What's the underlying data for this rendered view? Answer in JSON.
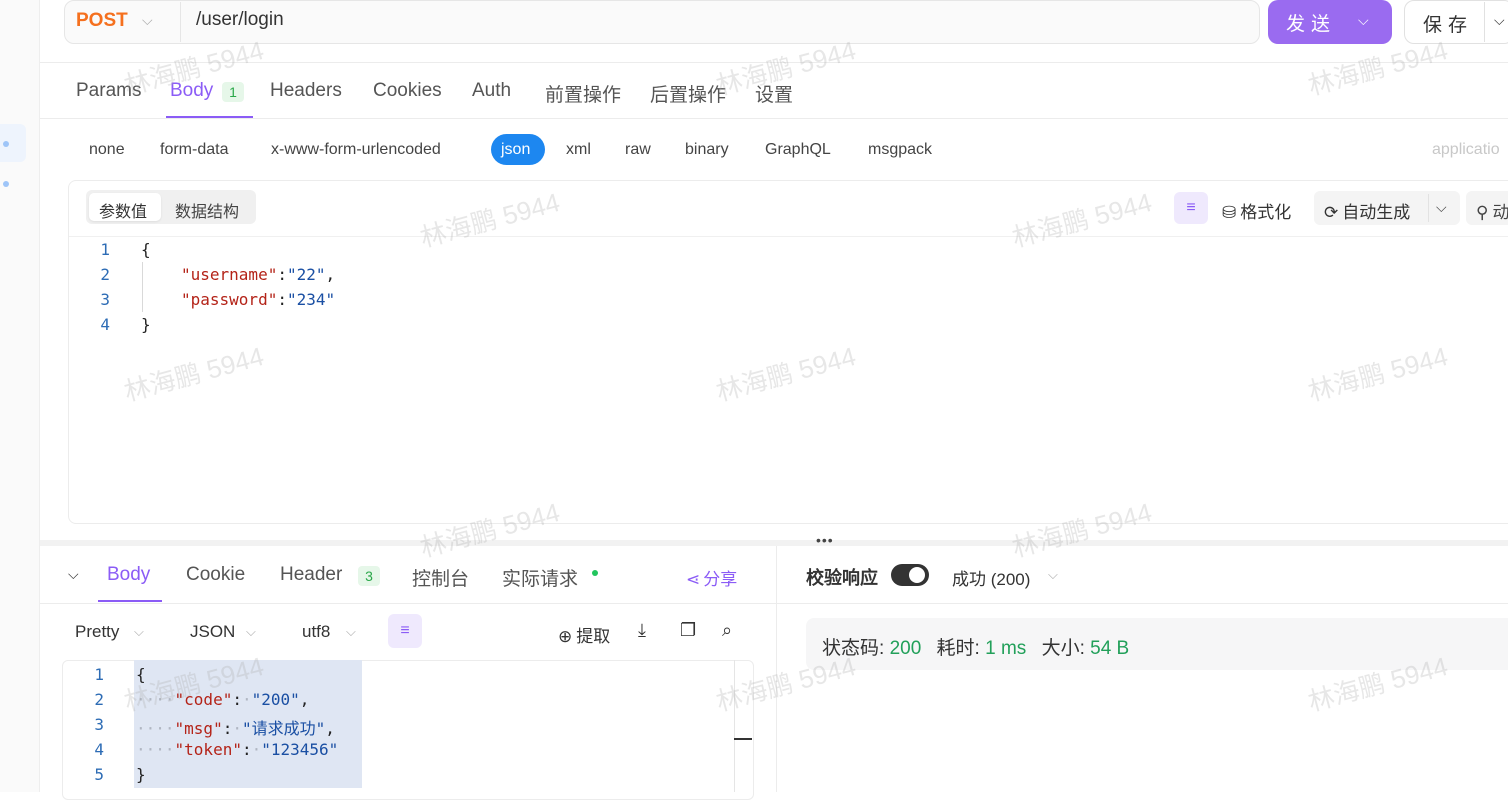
{
  "request": {
    "method": "POST",
    "url": "/user/login",
    "send_label": "发送",
    "save_label": "保存"
  },
  "request_tabs": [
    {
      "label": "Params"
    },
    {
      "label": "Body",
      "count": "1",
      "active": true
    },
    {
      "label": "Headers"
    },
    {
      "label": "Cookies"
    },
    {
      "label": "Auth"
    },
    {
      "label": "前置操作"
    },
    {
      "label": "后置操作"
    },
    {
      "label": "设置"
    }
  ],
  "body_types": [
    "none",
    "form-data",
    "x-www-form-urlencoded",
    "json",
    "xml",
    "raw",
    "binary",
    "GraphQL",
    "msgpack"
  ],
  "body_type_selected": "json",
  "content_type": "applicatio",
  "editor": {
    "segments": [
      "参数值",
      "数据结构"
    ],
    "format_label": "格式化",
    "autogen_label": "自动生成",
    "dynamic_label": "动",
    "line_numbers": [
      "1",
      "2",
      "3",
      "4"
    ],
    "lines": {
      "open": "{",
      "username_key": "\"username\"",
      "username_val": "\"22\"",
      "password_key": "\"password\"",
      "password_val": "\"234\"",
      "close": "}"
    }
  },
  "response": {
    "tabs": [
      {
        "label": "Body",
        "active": true
      },
      {
        "label": "Cookie"
      },
      {
        "label": "Header",
        "count": "3"
      },
      {
        "label": "控制台"
      },
      {
        "label": "实际请求"
      }
    ],
    "share_label": "分享",
    "format": {
      "pretty": "Pretty",
      "lang": "JSON",
      "encoding": "utf8"
    },
    "extract_label": "提取",
    "line_numbers": [
      "1",
      "2",
      "3",
      "4",
      "5"
    ],
    "lines": {
      "open": "{",
      "code_key": "\"code\"",
      "code_val": "\"200\"",
      "msg_key": "\"msg\"",
      "msg_val": "\"请求成功\"",
      "token_key": "\"token\"",
      "token_val": "\"123456\"",
      "close": "}"
    },
    "verify_label": "校验响应",
    "verify_result": "成功 (200)",
    "status": {
      "code_label": "状态码:",
      "code_value": "200",
      "time_label": "耗时:",
      "time_value": "1 ms",
      "size_label": "大小:",
      "size_value": "54 B"
    }
  },
  "watermark": "林海鹏 5944",
  "colors": {
    "accent": "#8b5cf6",
    "method": "#f5701e",
    "json_pill": "#1d87f0",
    "success": "#22a05a"
  }
}
